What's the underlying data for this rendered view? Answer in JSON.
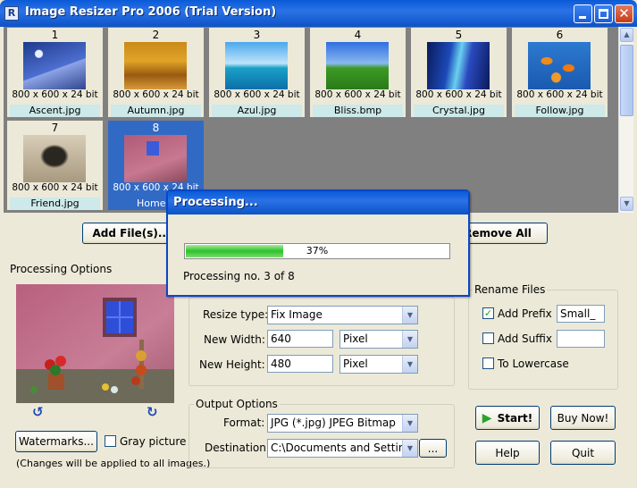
{
  "window": {
    "title": "Image Resizer Pro 2006 (Trial Version)",
    "icon_letter": "R",
    "close_glyph": "✕"
  },
  "thumbnails": [
    {
      "num": "1",
      "info": "800 x 600 x 24 bit",
      "name": "Ascent.jpg"
    },
    {
      "num": "2",
      "info": "800 x 600 x 24 bit",
      "name": "Autumn.jpg"
    },
    {
      "num": "3",
      "info": "800 x 600 x 24 bit",
      "name": "Azul.jpg"
    },
    {
      "num": "4",
      "info": "800 x 600 x 24 bit",
      "name": "Bliss.bmp"
    },
    {
      "num": "5",
      "info": "800 x 600 x 24 bit",
      "name": "Crystal.jpg"
    },
    {
      "num": "6",
      "info": "800 x 600 x 24 bit",
      "name": "Follow.jpg"
    },
    {
      "num": "7",
      "info": "800 x 600 x 24 bit",
      "name": "Friend.jpg"
    },
    {
      "num": "8",
      "info": "800 x 600 x 24 bit",
      "name": "Home..."
    }
  ],
  "buttons": {
    "add_files": "Add File(s)...",
    "remove_all": "Remove All",
    "watermarks": "Watermarks...",
    "start": "Start!",
    "buy_now": "Buy Now!",
    "help": "Help",
    "quit": "Quit",
    "browse": "..."
  },
  "processing_options": {
    "label": "Processing Options",
    "gray_picture": "Gray picture",
    "gray_checked": false,
    "note": "(Changes will be applied to all images.)"
  },
  "resize": {
    "type_label": "Resize type:",
    "type_value": "Fix Image",
    "width_label": "New Width:",
    "width_value": "640",
    "width_unit": "Pixel",
    "height_label": "New Height:",
    "height_value": "480",
    "height_unit": "Pixel"
  },
  "output": {
    "label": "Output Options",
    "format_label": "Format:",
    "format_value": "JPG (*.jpg) JPEG Bitmap",
    "dest_label": "Destination:",
    "dest_value": "C:\\Documents and Setting"
  },
  "rename": {
    "label": "Rename Files",
    "add_prefix": "Add Prefix",
    "prefix_checked": true,
    "prefix_value": "Small_",
    "add_suffix": "Add Suffix",
    "suffix_checked": false,
    "suffix_value": "",
    "lowercase": "To Lowercase",
    "lowercase_checked": false
  },
  "dialog": {
    "title": "Processing...",
    "progress": 0.37,
    "progress_text": "37%",
    "status": "Processing no. 3 of 8"
  },
  "icons": {
    "rotate_left": "↺",
    "rotate_right": "↻",
    "dropdown": "▼",
    "scroll_up": "▲",
    "scroll_down": "▼",
    "check": "✓",
    "play": "▶"
  },
  "colors": {
    "accent": "#316ac5",
    "titlebar": "#0a5ad8",
    "progress": "#2cc12c",
    "filename_bg": "#cde9e9"
  }
}
